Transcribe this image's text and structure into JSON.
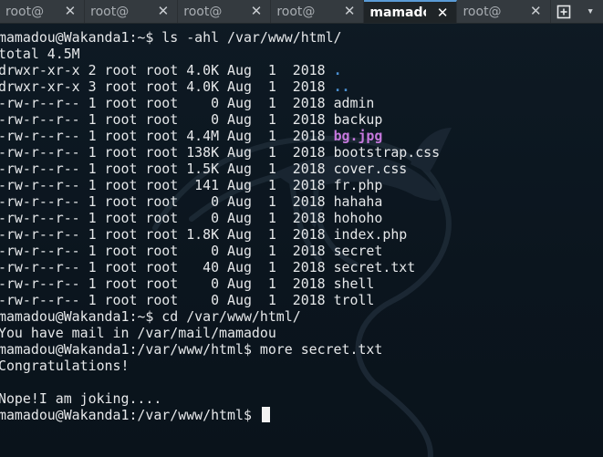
{
  "tabs": [
    {
      "label": "root@",
      "active": false
    },
    {
      "label": "root@",
      "active": false
    },
    {
      "label": "root@",
      "active": false
    },
    {
      "label": "root@",
      "active": false
    },
    {
      "label": "mamadou@",
      "active": true
    },
    {
      "label": "root@",
      "active": false
    }
  ],
  "tab_close_glyph": "✕",
  "new_tab_icon": "new-tab-icon",
  "dropdown_glyph": "▾",
  "terminal": {
    "lines": [
      {
        "text": "mamadou@Wakanda1:~$ ls -ahl /var/www/html/"
      },
      {
        "text": "total 4.5M"
      },
      {
        "prefix": "drwxr-xr-x 2 root root 4.0K Aug  1  2018 ",
        "name": ".",
        "kind": "dir"
      },
      {
        "prefix": "drwxr-xr-x 3 root root 4.0K Aug  1  2018 ",
        "name": "..",
        "kind": "dir"
      },
      {
        "prefix": "-rw-r--r-- 1 root root    0 Aug  1  2018 ",
        "name": "admin",
        "kind": "file"
      },
      {
        "prefix": "-rw-r--r-- 1 root root    0 Aug  1  2018 ",
        "name": "backup",
        "kind": "file"
      },
      {
        "prefix": "-rw-r--r-- 1 root root 4.4M Aug  1  2018 ",
        "name": "bg.jpg",
        "kind": "image"
      },
      {
        "prefix": "-rw-r--r-- 1 root root 138K Aug  1  2018 ",
        "name": "bootstrap.css",
        "kind": "file"
      },
      {
        "prefix": "-rw-r--r-- 1 root root 1.5K Aug  1  2018 ",
        "name": "cover.css",
        "kind": "file"
      },
      {
        "prefix": "-rw-r--r-- 1 root root  141 Aug  1  2018 ",
        "name": "fr.php",
        "kind": "file"
      },
      {
        "prefix": "-rw-r--r-- 1 root root    0 Aug  1  2018 ",
        "name": "hahaha",
        "kind": "file"
      },
      {
        "prefix": "-rw-r--r-- 1 root root    0 Aug  1  2018 ",
        "name": "hohoho",
        "kind": "file"
      },
      {
        "prefix": "-rw-r--r-- 1 root root 1.8K Aug  1  2018 ",
        "name": "index.php",
        "kind": "file"
      },
      {
        "prefix": "-rw-r--r-- 1 root root    0 Aug  1  2018 ",
        "name": "secret",
        "kind": "file"
      },
      {
        "prefix": "-rw-r--r-- 1 root root   40 Aug  1  2018 ",
        "name": "secret.txt",
        "kind": "file"
      },
      {
        "prefix": "-rw-r--r-- 1 root root    0 Aug  1  2018 ",
        "name": "shell",
        "kind": "file"
      },
      {
        "prefix": "-rw-r--r-- 1 root root    0 Aug  1  2018 ",
        "name": "troll",
        "kind": "file"
      },
      {
        "text": "mamadou@Wakanda1:~$ cd /var/www/html/"
      },
      {
        "text": "You have mail in /var/mail/mamadou"
      },
      {
        "text": "mamadou@Wakanda1:/var/www/html$ more secret.txt"
      },
      {
        "text": "Congratulations!"
      },
      {
        "text": ""
      },
      {
        "text": "Nope!I am joking...."
      },
      {
        "text": "mamadou@Wakanda1:/var/www/html$ ",
        "cursor": true
      }
    ]
  },
  "colors": {
    "background": "#0b1620",
    "text": "#e6e8ea",
    "directory": "#4a8fd0",
    "image_file": "#c678dd",
    "tabbar": "#343a3f"
  },
  "watermark_icon": "kali-dragon-icon"
}
